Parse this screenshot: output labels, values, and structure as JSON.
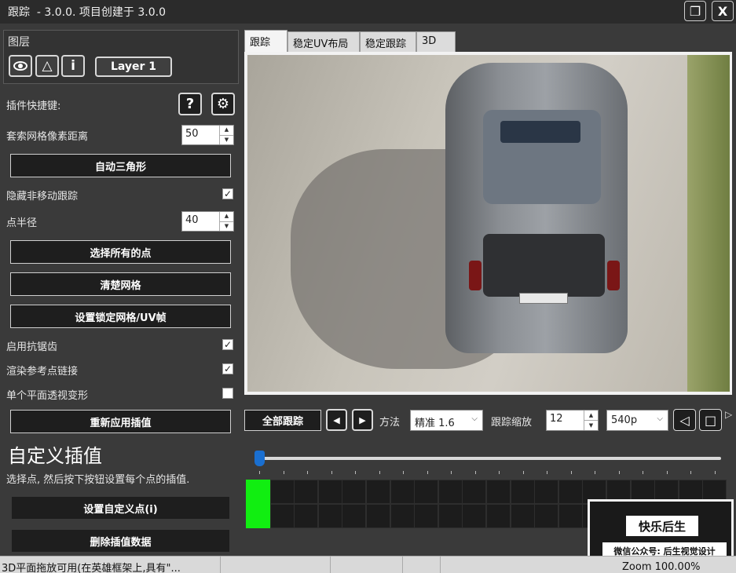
{
  "window": {
    "title": "跟踪  - 3.0.0. 项目创建于 3.0.0",
    "restore_glyph": "❐",
    "close_label": "X"
  },
  "layers": {
    "heading": "图层",
    "eye_glyph": "👁",
    "triangle_glyph": "△",
    "info_glyph": "i",
    "layer_button": "Layer 1"
  },
  "plugin_shortcuts": {
    "label": "插件快捷键:",
    "help_glyph": "?",
    "gear_glyph": "⚙"
  },
  "lasso": {
    "label": "套索网格像素距离",
    "value": "50"
  },
  "buttons": {
    "auto_triangle": "自动三角形",
    "select_all_points": "选择所有的点",
    "clear_grid": "清楚网格",
    "set_lock_grid": "设置锁定网格/UV帧",
    "reapply_interp": "重新应用插值",
    "set_custom_point": "设置自定义点(i)",
    "delete_interp_data": "删除插值数据"
  },
  "options": {
    "hide_non_moving": {
      "label": "隐藏非移动跟踪",
      "checked": true,
      "mark": "✓"
    },
    "point_radius": {
      "label": "点半径",
      "value": "40"
    },
    "antialias": {
      "label": "启用抗锯齿",
      "checked": true,
      "mark": "✓"
    },
    "render_ref_links": {
      "label": "渲染参考点链接",
      "checked": true,
      "mark": "✓"
    },
    "single_plane": {
      "label": "单个平面透视变形",
      "checked": false,
      "mark": ""
    }
  },
  "custom_interp": {
    "heading": "自定义插值",
    "description": "选择点, 然后按下按钮设置每个点的插值."
  },
  "tabs": [
    "跟踪",
    "稳定UV布局",
    "稳定跟踪",
    "3D"
  ],
  "tracking": {
    "track_all": "全部跟踪",
    "prev_glyph": "◀",
    "next_glyph": "▶",
    "method_label": "方法",
    "method_value": "精准 1.6",
    "scale_label": "跟踪缩放",
    "scale_value": "12",
    "resolution": "540p",
    "rewind_glyph": "◁",
    "stop_glyph": "□",
    "more_glyph": "▷"
  },
  "status": {
    "message": "3D平面拖放可用(在英雄框架上,具有\"...",
    "zoom": "Zoom 100.00%"
  },
  "watermark": {
    "line1": "快乐后生",
    "line2": "微信公众号: 后生视觉设计"
  },
  "colors": {
    "keyframe_green": "#11ee11",
    "timeline_marker": "#1a6fd0",
    "panel_bg": "#3a3a3a"
  }
}
